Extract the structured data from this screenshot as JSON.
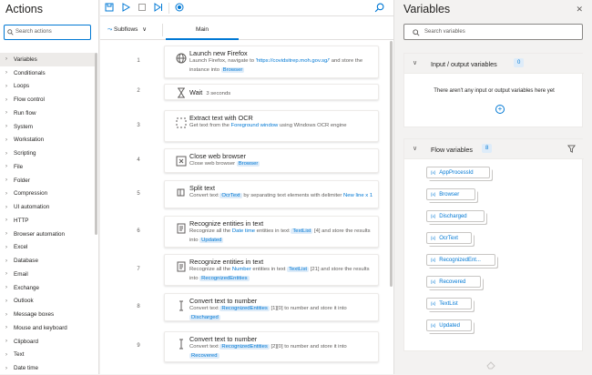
{
  "actions": {
    "title": "Actions",
    "search_placeholder": "Search actions",
    "categories": [
      "Variables",
      "Conditionals",
      "Loops",
      "Flow control",
      "Run flow",
      "System",
      "Workstation",
      "Scripting",
      "File",
      "Folder",
      "Compression",
      "UI automation",
      "HTTP",
      "Browser automation",
      "Excel",
      "Database",
      "Email",
      "Exchange",
      "Outlook",
      "Message boxes",
      "Mouse and keyboard",
      "Clipboard",
      "Text",
      "Date time"
    ]
  },
  "designer": {
    "subflows_label": "Subflows",
    "main_tab": "Main",
    "steps": [
      {
        "num": "1",
        "title": "Launch new Firefox",
        "desc": [
          {
            "t": "Launch Firefox, navigate to "
          },
          {
            "t": "'https://covidsitrep.moh.gov.sg/'",
            "k": "link"
          },
          {
            "t": " and store the instance into "
          },
          {
            "t": "Browser",
            "k": "tok"
          }
        ]
      },
      {
        "num": "2",
        "title": "Wait",
        "inline": "3 seconds"
      },
      {
        "num": "3",
        "title": "Extract text with OCR",
        "desc": [
          {
            "t": "Get text from the "
          },
          {
            "t": "Foreground window",
            "k": "link"
          },
          {
            "t": " using Windows OCR engine"
          }
        ]
      },
      {
        "num": "4",
        "title": "Close web browser",
        "desc": [
          {
            "t": "Close web browser "
          },
          {
            "t": "Browser",
            "k": "tok"
          }
        ]
      },
      {
        "num": "5",
        "title": "Split text",
        "desc": [
          {
            "t": "Convert text "
          },
          {
            "t": "OcrText",
            "k": "tok"
          },
          {
            "t": " by separating text elements with delimiter "
          },
          {
            "t": "New line x 1",
            "k": "link"
          }
        ]
      },
      {
        "num": "6",
        "title": "Recognize entities in text",
        "desc": [
          {
            "t": "Recognize all the "
          },
          {
            "t": "Date time",
            "k": "link"
          },
          {
            "t": " entities in text "
          },
          {
            "t": "TextList",
            "k": "tok"
          },
          {
            "t": " [4] and store the results into "
          },
          {
            "t": "Updated",
            "k": "tok"
          }
        ]
      },
      {
        "num": "7",
        "title": "Recognize entities in text",
        "desc": [
          {
            "t": "Recognize all the "
          },
          {
            "t": "Number",
            "k": "link"
          },
          {
            "t": " entities in text "
          },
          {
            "t": "TextList",
            "k": "tok"
          },
          {
            "t": " [21] and store the results into "
          },
          {
            "t": "RecognizedEntities",
            "k": "tok"
          }
        ]
      },
      {
        "num": "8",
        "title": "Convert text to number",
        "desc": [
          {
            "t": "Convert text "
          },
          {
            "t": "RecognizedEntities",
            "k": "tok"
          },
          {
            "t": " [1][0] to number and store it into "
          },
          {
            "t": "Discharged",
            "k": "tok"
          }
        ]
      },
      {
        "num": "9",
        "title": "Convert text to number",
        "desc": [
          {
            "t": "Convert text "
          },
          {
            "t": "RecognizedEntities",
            "k": "tok"
          },
          {
            "t": " [2][0] to number and store it into "
          },
          {
            "t": "Recovered",
            "k": "tok"
          }
        ]
      }
    ]
  },
  "variables": {
    "title": "Variables",
    "search_placeholder": "Search variables",
    "io_label": "Input / output variables",
    "io_count": "0",
    "io_empty": "There aren't any input or output variables here yet",
    "flow_label": "Flow variables",
    "flow_count": "8",
    "flow_vars": [
      "AppProcessId",
      "Browser",
      "Discharged",
      "OcrText",
      "RecognizedEnt...",
      "Recovered",
      "TextList",
      "Updated"
    ]
  },
  "colors": {
    "accent": "#0078d4",
    "token_bg": "#deecf9",
    "panel_bg": "#f3f2f1"
  }
}
